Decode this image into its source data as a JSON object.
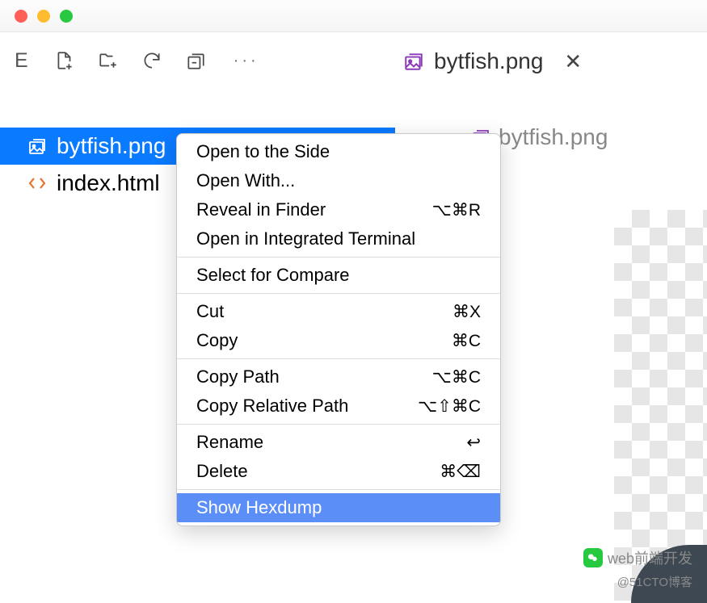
{
  "toolbar": {
    "letter": "E"
  },
  "sidebar": {
    "files": [
      {
        "name": "bytfish.png",
        "type": "image",
        "selected": true
      },
      {
        "name": "index.html",
        "type": "html",
        "selected": false
      }
    ]
  },
  "tab": {
    "label": "bytfish.png"
  },
  "breadcrumb": {
    "label": "bytfish.png"
  },
  "context_menu": {
    "groups": [
      [
        {
          "label": "Open to the Side",
          "shortcut": ""
        },
        {
          "label": "Open With...",
          "shortcut": ""
        },
        {
          "label": "Reveal in Finder",
          "shortcut": "⌥⌘R"
        },
        {
          "label": "Open in Integrated Terminal",
          "shortcut": ""
        }
      ],
      [
        {
          "label": "Select for Compare",
          "shortcut": ""
        }
      ],
      [
        {
          "label": "Cut",
          "shortcut": "⌘X"
        },
        {
          "label": "Copy",
          "shortcut": "⌘C"
        }
      ],
      [
        {
          "label": "Copy Path",
          "shortcut": "⌥⌘C"
        },
        {
          "label": "Copy Relative Path",
          "shortcut": "⌥⇧⌘C"
        }
      ],
      [
        {
          "label": "Rename",
          "shortcut": "↩"
        },
        {
          "label": "Delete",
          "shortcut": "⌘⌫"
        }
      ],
      [
        {
          "label": "Show Hexdump",
          "shortcut": "",
          "highlighted": true
        }
      ]
    ]
  },
  "watermark": {
    "text": "web前端开发",
    "sub": "@51CTO博客"
  }
}
